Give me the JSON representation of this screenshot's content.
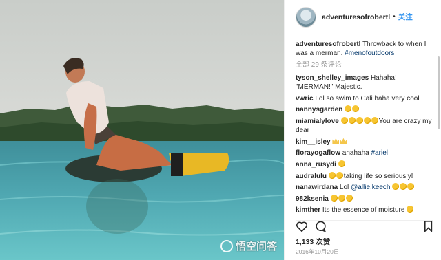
{
  "post": {
    "username": "adventuresofrobertl",
    "separator": "•",
    "follow_label": "关注",
    "caption_user": "adventuresofrobertl",
    "caption_text": "Throwback to when I was a merman.",
    "caption_tag": "#menofoutdoors",
    "view_all": "全部 29 条评论",
    "likes": "1,133 次赞",
    "date": "2016年10月20日"
  },
  "comments": [
    {
      "user": "tyson_shelley_images",
      "text": "Hahaha! \"MERMAN!\" Majestic.",
      "emoji": []
    },
    {
      "user": "vwric",
      "text": "Lol so swim to Cali haha very cool",
      "emoji": []
    },
    {
      "user": "nannysgarden",
      "text": "",
      "emoji": [
        "face",
        "face"
      ]
    },
    {
      "user": "miamialylove",
      "text": "You are crazy my dear",
      "emoji": [
        "face",
        "face",
        "face",
        "face",
        "face"
      ]
    },
    {
      "user": "kim__isley",
      "text": "",
      "emoji": [
        "crown",
        "crown"
      ]
    },
    {
      "user": "florayogaflow",
      "text": "ahahaha",
      "tag": "#ariel",
      "emoji": []
    },
    {
      "user": "anna_rusydi",
      "text": "",
      "emoji": [
        "face"
      ]
    },
    {
      "user": "audralulu",
      "text": "taking life so seriously!",
      "emoji": [
        "face",
        "face"
      ]
    },
    {
      "user": "nanawirdana",
      "text": "Lol",
      "mention": "@allie.keech",
      "emoji": [
        "face",
        "face",
        "face"
      ]
    },
    {
      "user": "982ksenia",
      "text": "",
      "emoji": [
        "face",
        "face",
        "face"
      ]
    },
    {
      "user": "kimther",
      "text": "Its the essence of moisture",
      "emoji": [
        "face"
      ]
    }
  ],
  "icons": {
    "like": "heart-icon",
    "comment": "comment-icon",
    "save": "bookmark-icon"
  },
  "watermark": {
    "text": "悟空问答"
  }
}
